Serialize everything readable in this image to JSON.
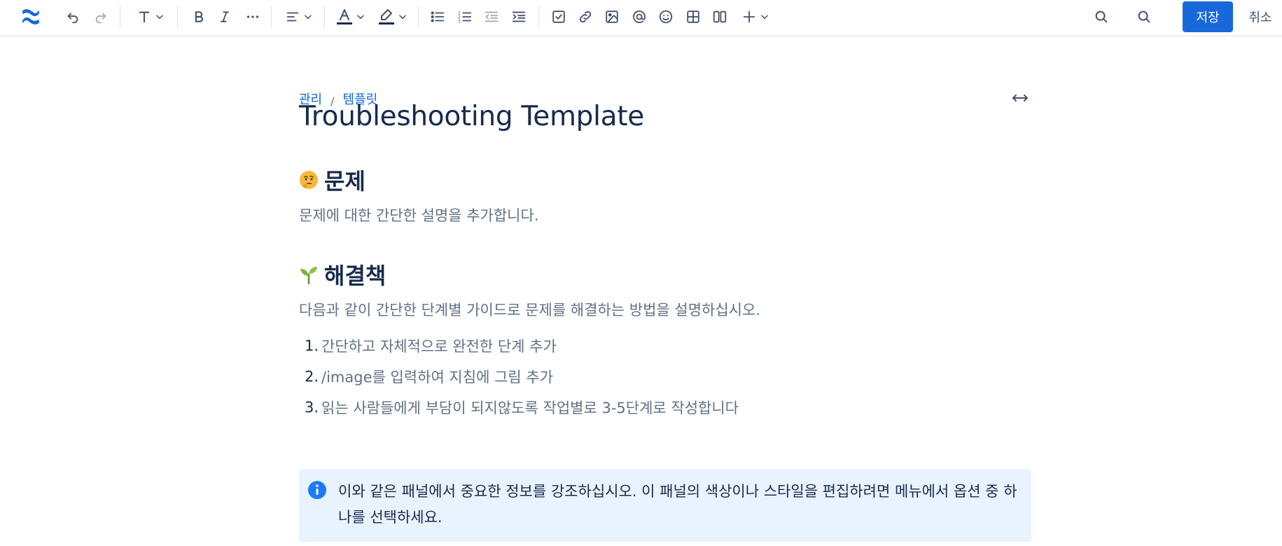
{
  "toolbar": {
    "logo_icon": "confluence-logo-icon",
    "save_label": "저장",
    "cancel_label": "취소",
    "accent_color": "#1868db",
    "text_color_underline": "#172b4d",
    "highlight_color_underline": "#172b4d"
  },
  "breadcrumb": {
    "items": [
      "관리",
      "템플릿"
    ],
    "separator": "/"
  },
  "page": {
    "title": "Troubleshooting Template"
  },
  "sections": {
    "problem": {
      "emoji": "thinking-face-icon",
      "heading": "문제",
      "body": "문제에 대한 간단한 설명을 추가합니다."
    },
    "solution": {
      "emoji": "seedling-icon",
      "heading": "해결책",
      "body": "다음과 같이 간단한 단계별 가이드로 문제를 해결하는 방법을 설명하십시오.",
      "steps": [
        {
          "num": "1.",
          "text": "간단하고 자체적으로 완전한 단계 추가"
        },
        {
          "num": "2.",
          "text": "/image를 입력하여 지침에 그림 추가"
        },
        {
          "num": "3.",
          "text": "읽는 사람들에게 부담이 되지않도록 작업별로 3-5단계로 작성합니다"
        }
      ]
    }
  },
  "panel": {
    "icon": "info-icon",
    "text": "이와 같은 패널에서 중요한 정보를 강조하십시오. 이 패널의 색상이나 스타일을 편집하려면 메뉴에서 옵션 중 하나를 선택하세요.",
    "background": "#e9f2ff"
  }
}
